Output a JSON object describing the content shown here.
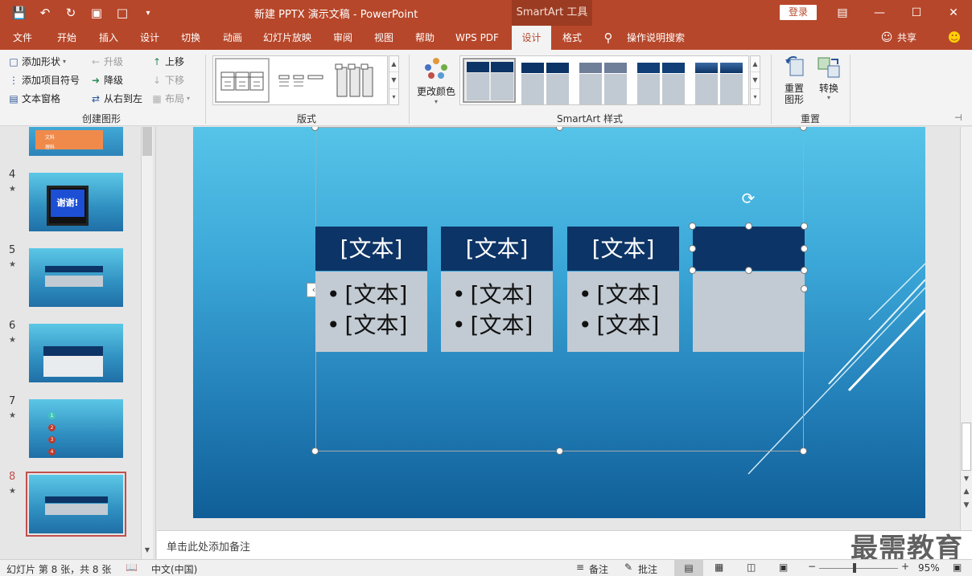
{
  "titlebar": {
    "doc_title": "新建 PPTX 演示文稿  -  PowerPoint",
    "context_title": "SmartArt 工具",
    "login": "登录",
    "qat_icons": [
      "save-icon",
      "undo-icon",
      "redo-icon",
      "present-icon",
      "new-icon",
      "customize-icon"
    ]
  },
  "tabs": [
    "文件",
    "开始",
    "插入",
    "设计",
    "切换",
    "动画",
    "幻灯片放映",
    "审阅",
    "视图",
    "帮助",
    "WPS PDF",
    "设计",
    "格式"
  ],
  "tell_me": "操作说明搜索",
  "share": "共享",
  "ribbon": {
    "create": {
      "add_shape": "添加形状",
      "add_bullet": "添加项目符号",
      "text_pane": "文本窗格",
      "promote": "升级",
      "demote": "降级",
      "rtl": "从右到左",
      "move_up": "上移",
      "move_down": "下移",
      "layout": "布局",
      "label": "创建图形"
    },
    "layouts_label": "版式",
    "change_colors": "更改颜色",
    "styles_label": "SmartArt 样式",
    "reset": {
      "reset_graphic": "重置\n图形",
      "reset_graphic_l1": "重置",
      "reset_graphic_l2": "图形",
      "convert": "转换",
      "label": "重置"
    }
  },
  "slides": [
    {
      "num": "4",
      "star": "★",
      "caption": "谢谢!"
    },
    {
      "num": "5",
      "star": "★"
    },
    {
      "num": "6",
      "star": "★"
    },
    {
      "num": "7",
      "star": "★",
      "items": [
        "1",
        "2",
        "3",
        "4"
      ]
    },
    {
      "num": "8",
      "star": "★"
    }
  ],
  "thumb3_labels": [
    "文科",
    "理科"
  ],
  "smartart": {
    "headers": [
      "[文本]",
      "[文本]",
      "[文本]",
      ""
    ],
    "bullets": [
      [
        "[文本]",
        "[文本]"
      ],
      [
        "[文本]",
        "[文本]"
      ],
      [
        "[文本]",
        "[文本]"
      ],
      []
    ]
  },
  "notes_placeholder": "单击此处添加备注",
  "status": {
    "slide_info": "幻灯片 第 8 张，共 8 张",
    "language": "中文(中国)",
    "notes": "备注",
    "comments": "批注",
    "zoom": "95%"
  },
  "watermark": "最需教育"
}
